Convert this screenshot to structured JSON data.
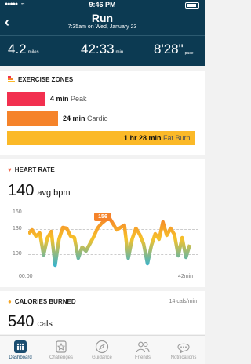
{
  "status": {
    "time": "9:46 PM",
    "signal": "●●●●●"
  },
  "header": {
    "title": "Run",
    "subtitle": "7:35am on Wed, January 23",
    "stats": [
      {
        "value": "4.2",
        "unit": "miles"
      },
      {
        "value": "42:33",
        "unit": "min"
      },
      {
        "value": "8'28\"",
        "unit": "pace"
      }
    ]
  },
  "zones": {
    "title": "EXERCISE ZONES",
    "items": [
      {
        "value": "4 min",
        "label": "Peak",
        "minutes": 4,
        "color": "#f2304f"
      },
      {
        "value": "24 min",
        "label": "Cardio",
        "minutes": 24,
        "color": "#f5832a"
      },
      {
        "value": "1 hr 28 min",
        "label": "Fat Burn",
        "minutes": 88,
        "color": "#fbb928"
      }
    ]
  },
  "heart_rate": {
    "title": "HEART RATE",
    "value": "140",
    "unit": "avg bpm",
    "peak_badge": "156"
  },
  "chart_data": {
    "type": "area",
    "title": "",
    "xlabel": "",
    "ylabel": "",
    "y_ticks": [
      "160",
      "130",
      "100"
    ],
    "x_ticks": [
      "00:00",
      "42min"
    ],
    "xlim": [
      0,
      42
    ],
    "ylim": [
      85,
      165
    ],
    "grid": true,
    "series": [
      {
        "x": [
          0,
          1,
          2,
          3,
          4,
          5,
          6,
          7,
          8,
          9,
          10,
          11,
          12,
          13,
          14,
          15,
          16,
          17,
          18,
          19,
          20,
          21,
          22,
          23,
          24,
          25,
          26,
          27,
          28,
          29,
          30,
          31,
          32,
          33,
          34,
          35,
          36,
          37,
          38,
          39,
          40,
          41,
          42
        ],
        "values": [
          135,
          140,
          132,
          136,
          108,
          130,
          138,
          95,
          128,
          143,
          142,
          132,
          130,
          104,
          118,
          113,
          122,
          131,
          142,
          148,
          152,
          156,
          148,
          140,
          143,
          146,
          104,
          128,
          142,
          134,
          122,
          97,
          120,
          135,
          128,
          150,
          133,
          142,
          134,
          107,
          130,
          105,
          121
        ]
      }
    ],
    "colors": {
      "high": "#f5832a",
      "mid": "#f6c22a",
      "low": "#3bb3c9"
    }
  },
  "calories": {
    "title": "CALORIES BURNED",
    "rate": "14 cals/min",
    "value": "540",
    "unit": "cals"
  },
  "tabs": [
    {
      "label": "Dashboard",
      "icon": "dashboard-icon",
      "active": true
    },
    {
      "label": "Challenges",
      "icon": "challenges-icon",
      "active": false
    },
    {
      "label": "Guidance",
      "icon": "compass-icon",
      "active": false
    },
    {
      "label": "Friends",
      "icon": "friends-icon",
      "active": false
    },
    {
      "label": "Notifications",
      "icon": "notifications-icon",
      "active": false
    }
  ]
}
